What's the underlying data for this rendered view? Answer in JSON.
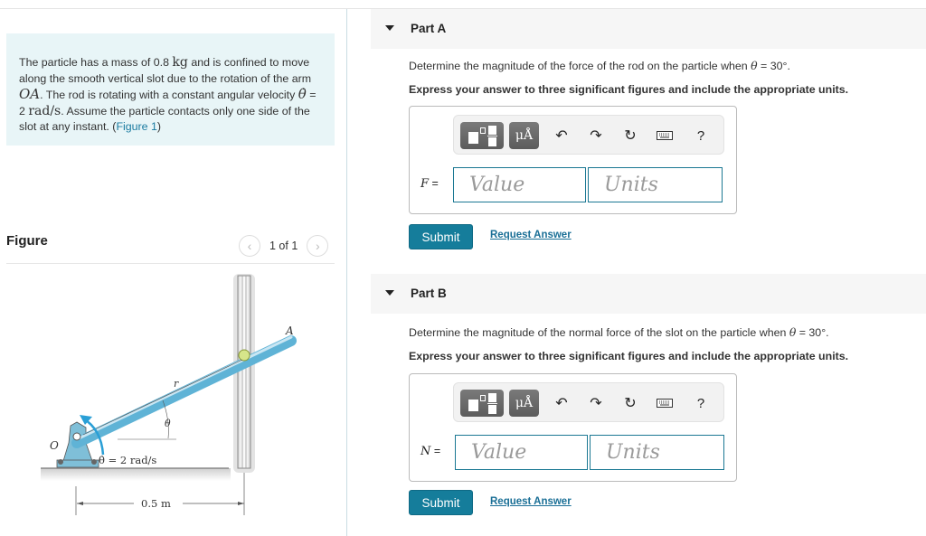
{
  "problem": {
    "text_1": "The particle has a mass of 0.8 ",
    "unit_kg": "kg",
    "text_2": " and is confined to move along the smooth vertical slot due to the rotation of the arm ",
    "arm": "OA",
    "text_3": ". The rod is rotating with a constant angular velocity ",
    "theta_dot": "θ̇",
    "text_4": " = 2 ",
    "unit_rad": "rad/s",
    "text_5": ". Assume the particle contacts only one side of the slot at any instant. (",
    "figure_link": "Figure 1",
    "text_6": ")"
  },
  "figure": {
    "title": "Figure",
    "pager_text": "1 of 1",
    "prev_icon": "chevron-left-icon",
    "next_icon": "chevron-right-icon",
    "labels": {
      "A": "A",
      "O": "O",
      "r": "r",
      "theta": "θ",
      "omega": "θ̇ = 2 rad/s",
      "distance": "0.5 m"
    },
    "colors": {
      "rod": "#5fb3d6",
      "slot": "#f4f4f4",
      "particle": "#d6e58a",
      "arrow": "#2a9fd6"
    }
  },
  "parts": [
    {
      "label": "Part A",
      "question_pre": "Determine the magnitude of the force of the rod on the particle when ",
      "question_theta": "θ",
      "question_post": " = 30°.",
      "instruction": "Express your answer to three significant figures and include the appropriate units.",
      "var": "F",
      "eq": " =",
      "value_placeholder": "Value",
      "units_placeholder": "Units",
      "submit": "Submit",
      "request": "Request Answer"
    },
    {
      "label": "Part B",
      "question_pre": "Determine the magnitude of the normal force of the slot on the particle when ",
      "question_theta": "θ",
      "question_post": " = 30°.",
      "instruction": "Express your answer to three significant figures and include the appropriate units.",
      "var": "N",
      "eq": " =",
      "value_placeholder": "Value",
      "units_placeholder": "Units",
      "submit": "Submit",
      "request": "Request Answer"
    }
  ],
  "toolbar": {
    "units_label": "μÅ",
    "undo": "↶",
    "redo": "↷",
    "reset": "↻",
    "help": "?"
  },
  "colors": {
    "accent": "#157d9b",
    "problem_bg": "#e8f5f7",
    "part_header_bg": "#f6f6f6"
  }
}
